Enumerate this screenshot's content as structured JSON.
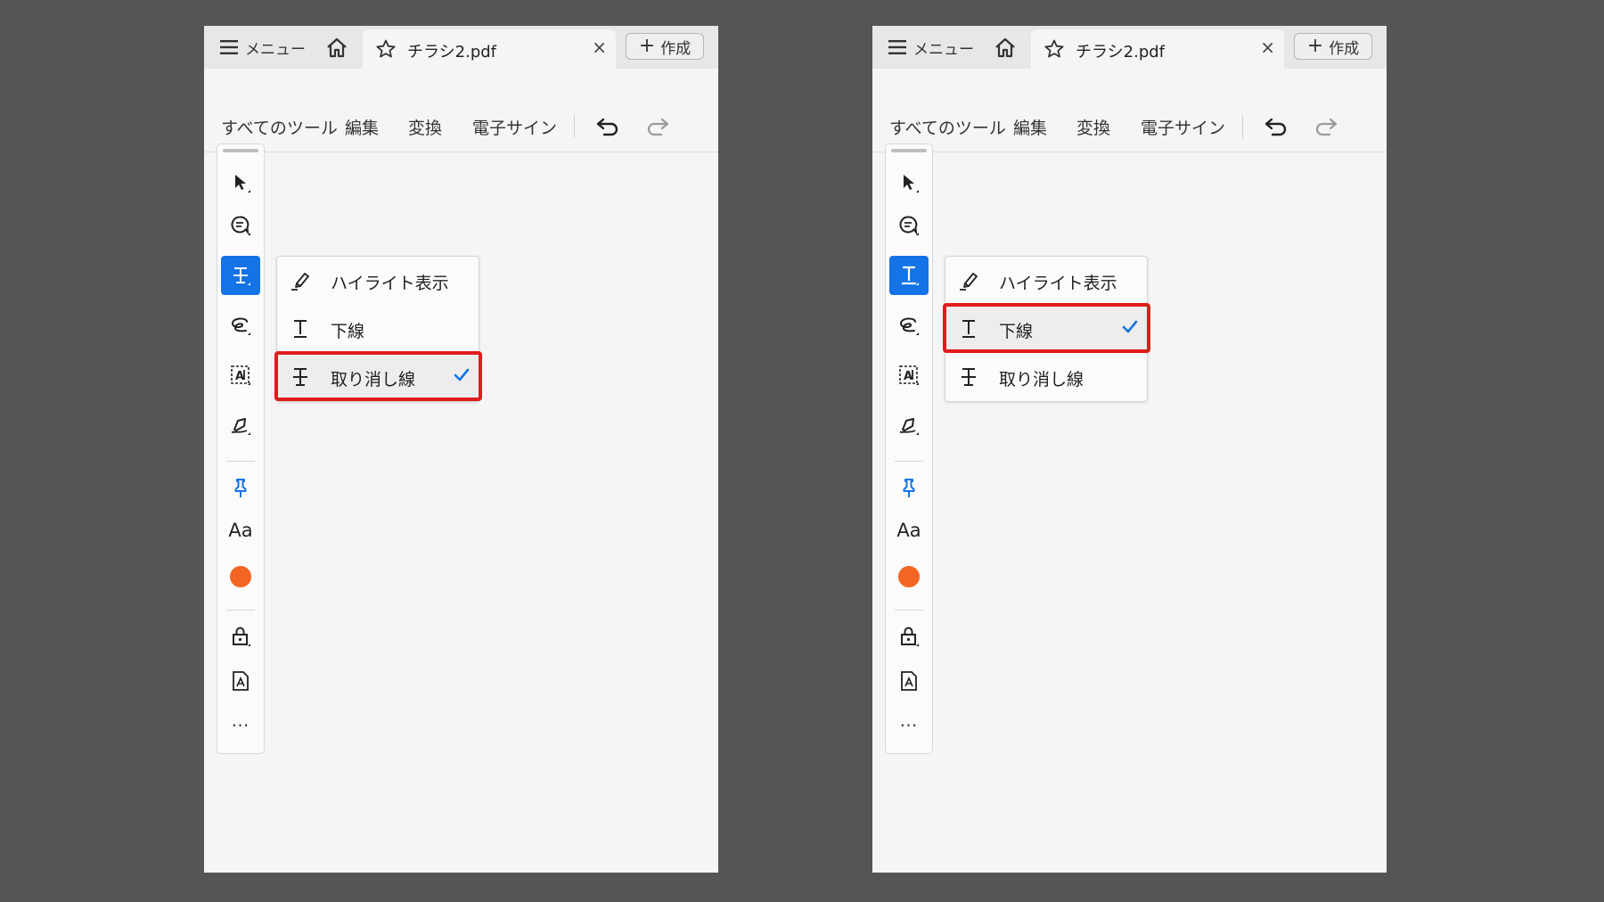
{
  "panels": [
    {
      "menu_label": "メニュー",
      "tab_title": "チラシ2.pdf",
      "tab_close": "×",
      "create_label": "作成",
      "toolbar": {
        "all_tools": "すべてのツール",
        "edit": "編集",
        "convert": "変換",
        "esign": "電子サイン"
      },
      "rail": {
        "text_style_label": "Aa",
        "more_label": "…",
        "color_dot": "#f26522",
        "active_tool_icon": "strikethrough-icon"
      },
      "flyout": {
        "items": [
          {
            "label": "ハイライト表示",
            "icon": "highlighter-icon",
            "checked": false
          },
          {
            "label": "下線",
            "icon": "underline-icon",
            "checked": false
          },
          {
            "label": "取り消し線",
            "icon": "strikethrough-icon",
            "checked": true
          }
        ]
      }
    },
    {
      "menu_label": "メニュー",
      "tab_title": "チラシ2.pdf",
      "tab_close": "×",
      "create_label": "作成",
      "toolbar": {
        "all_tools": "すべてのツール",
        "edit": "編集",
        "convert": "変換",
        "esign": "電子サイン"
      },
      "rail": {
        "text_style_label": "Aa",
        "more_label": "…",
        "color_dot": "#f26522",
        "active_tool_icon": "underline-icon"
      },
      "flyout": {
        "items": [
          {
            "label": "ハイライト表示",
            "icon": "highlighter-icon",
            "checked": false
          },
          {
            "label": "下線",
            "icon": "underline-icon",
            "checked": true
          },
          {
            "label": "取り消し線",
            "icon": "strikethrough-icon",
            "checked": false
          }
        ]
      }
    }
  ],
  "colors": {
    "accent": "#1473e6",
    "highlight_box": "#e11b1b",
    "background": "#555555",
    "pin": "#1473e6"
  }
}
